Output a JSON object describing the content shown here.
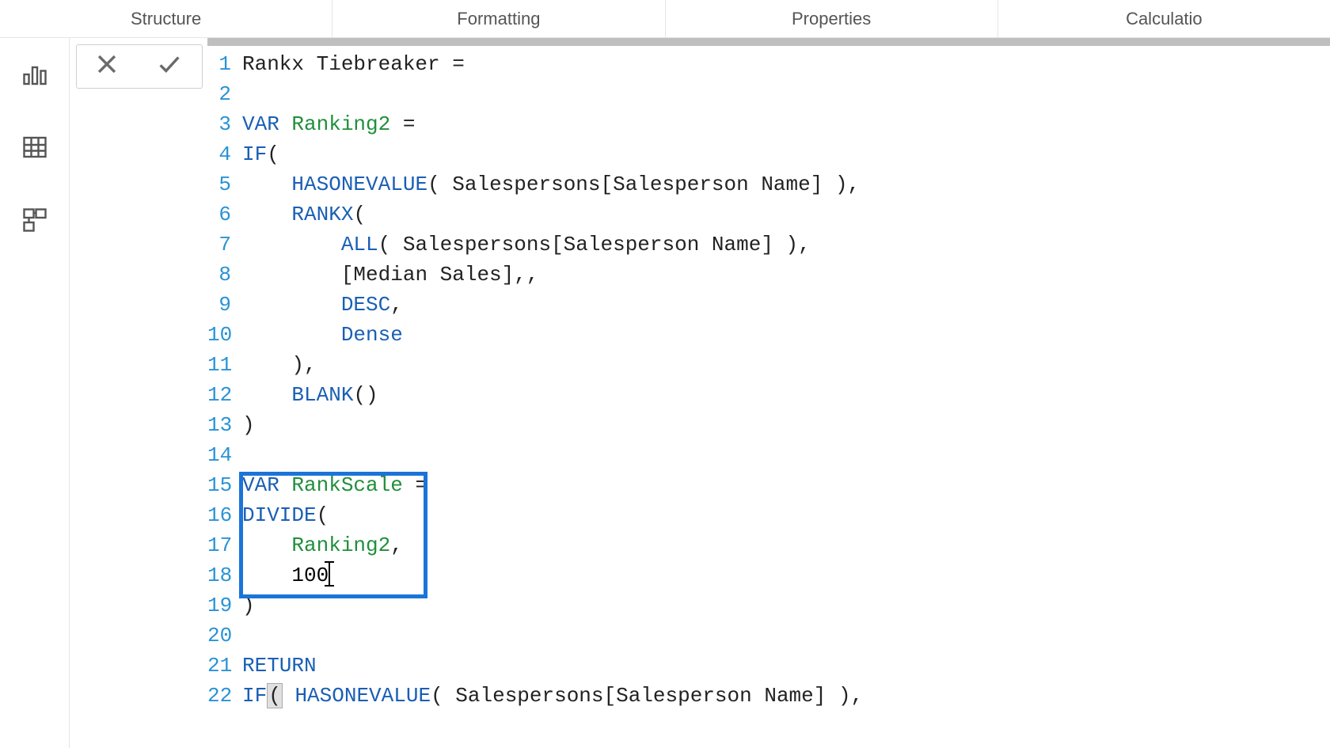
{
  "tabs": {
    "structure": "Structure",
    "formatting": "Formatting",
    "properties": "Properties",
    "calculation": "Calculatio"
  },
  "code": {
    "l1_name": "Rankx Tiebreaker =",
    "l2": "",
    "l3_var": "VAR",
    "l3_name": "Ranking2",
    "l3_eq": " =",
    "l4_if": "IF",
    "l4_paren": "(",
    "l5_fn": "HASONEVALUE",
    "l5_args": "( Salespersons[Salesperson Name] ),",
    "l6_fn": "RANKX",
    "l6_paren": "(",
    "l7_fn": "ALL",
    "l7_args": "( Salespersons[Salesperson Name] ),",
    "l8_col": "[Median Sales]",
    "l8_tail": ",,",
    "l9_desc": "DESC",
    "l9_tail": ",",
    "l10_dense": "Dense",
    "l11": "),",
    "l12_fn": "BLANK",
    "l12_paren": "()",
    "l13": ")",
    "l14": "",
    "l15_var": "VAR",
    "l15_name": "RankScale",
    "l15_eq": " =",
    "l16_fn": "DIVIDE",
    "l16_paren": "(",
    "l17_name": "Ranking2",
    "l17_tail": ",",
    "l18_num": "100",
    "l19": ")",
    "l20": "",
    "l21_return": "RETURN",
    "l22_if": "IF",
    "l22_paren": "(",
    "l22_fn": "HASONEVALUE",
    "l22_args": "( Salespersons[Salesperson Name] ),"
  },
  "line_numbers": [
    "1",
    "2",
    "3",
    "4",
    "5",
    "6",
    "7",
    "8",
    "9",
    "10",
    "11",
    "12",
    "13",
    "14",
    "15",
    "16",
    "17",
    "18",
    "19",
    "20",
    "21",
    "22"
  ]
}
